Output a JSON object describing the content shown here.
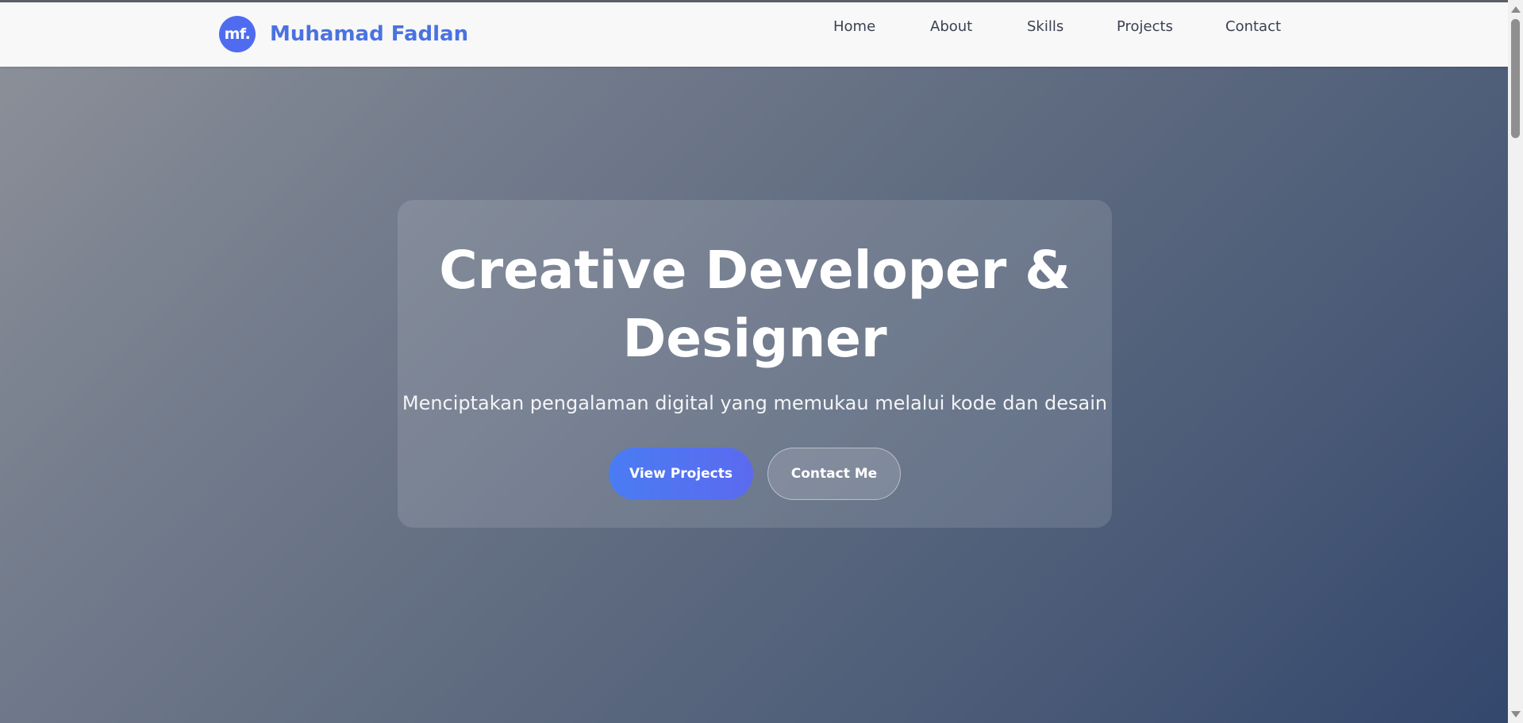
{
  "brand": {
    "logo_text": "mf.",
    "name": "Muhamad Fadlan"
  },
  "nav": {
    "items": [
      {
        "label": "Home"
      },
      {
        "label": "About"
      },
      {
        "label": "Skills"
      },
      {
        "label": "Projects"
      },
      {
        "label": "Contact"
      }
    ]
  },
  "hero": {
    "title_line1": "Creative Developer &",
    "title_line2": "Designer",
    "subtitle": "Menciptakan pengalaman digital yang memukau melalui kode dan desain",
    "primary_button": "View Projects",
    "secondary_button": "Contact Me"
  },
  "colors": {
    "accent": "#4f6cf0",
    "brand_text": "#4a72e0",
    "navbar_bg": "#f8f8f9"
  }
}
